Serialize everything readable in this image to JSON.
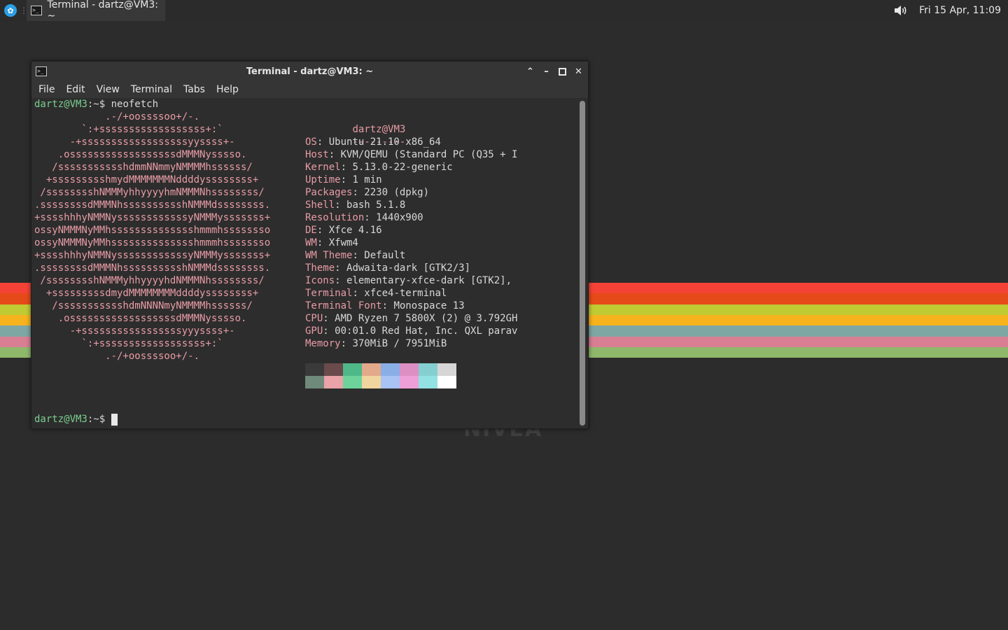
{
  "panel": {
    "app_menu_icon": "xfce-mouse-icon",
    "task_title": "Terminal - dartz@VM3: ~",
    "clock": "Fri 15 Apr, 11:09",
    "volume_icon": "volume-icon"
  },
  "wallpaper": {
    "text": "NIVEA",
    "stripe_colors": [
      "#f44336",
      "#e64a19",
      "#c0ca33",
      "#f6b31e",
      "#7ea7a4",
      "#d97f93",
      "#8fb86b"
    ]
  },
  "window": {
    "title": "Terminal - dartz@VM3: ~",
    "menu": [
      "File",
      "Edit",
      "View",
      "Terminal",
      "Tabs",
      "Help"
    ]
  },
  "terminal": {
    "prompt_user": "dartz@VM3",
    "prompt_path": ":~$",
    "command": " neofetch",
    "ascii_lines": [
      "            .-/+oossssoo+/-.",
      "        `:+ssssssssssssssssss+:`",
      "      -+ssssssssssssssssssyyssss+-",
      "    .ossssssssssssssssssdMMMNysssso.",
      "   /ssssssssssshdmmNNmmyNMMMMhssssss/",
      "  +ssssssssshmydMMMMMMMNddddyssssssss+",
      " /sssssssshNMMMyhhyyyyhmNMMMNhssssssss/",
      ".ssssssssdMMMNhsssssssssshNMMMdssssssss.",
      "+sssshhhyNMMNyssssssssssssyNMMMysssssss+",
      "ossyNMMMNyMMhsssssssssssssshmmmhssssssso",
      "ossyNMMMNyMMhsssssssssssssshmmmhssssssso",
      "+sssshhhyNMMNyssssssssssssyNMMMysssssss+",
      ".ssssssssdMMMNhsssssssssshNMMMdssssssss.",
      " /sssssssshNMMMyhhyyyyhdNMMMNhssssssss/",
      "  +sssssssssdmydMMMMMMMMddddyssssssss+",
      "   /ssssssssssshdmNNNNmyNMMMMhssssss/",
      "    .ossssssssssssssssssdMMMNysssso.",
      "      -+sssssssssssssssssyyyssss+-",
      "        `:+ssssssssssssssssss+:`",
      "            .-/+oossssoo+/-."
    ],
    "info_header": "dartz@VM3",
    "info_sep": "---------",
    "info": [
      {
        "key": "OS",
        "value": "Ubuntu 21.10 x86_64"
      },
      {
        "key": "Host",
        "value": "KVM/QEMU (Standard PC (Q35 + I"
      },
      {
        "key": "Kernel",
        "value": "5.13.0-22-generic"
      },
      {
        "key": "Uptime",
        "value": "1 min"
      },
      {
        "key": "Packages",
        "value": "2230 (dpkg)"
      },
      {
        "key": "Shell",
        "value": "bash 5.1.8"
      },
      {
        "key": "Resolution",
        "value": "1440x900"
      },
      {
        "key": "DE",
        "value": "Xfce 4.16"
      },
      {
        "key": "WM",
        "value": "Xfwm4"
      },
      {
        "key": "WM Theme",
        "value": "Default"
      },
      {
        "key": "Theme",
        "value": "Adwaita-dark [GTK2/3]"
      },
      {
        "key": "Icons",
        "value": "elementary-xfce-dark [GTK2],"
      },
      {
        "key": "Terminal",
        "value": "xfce4-terminal"
      },
      {
        "key": "Terminal Font",
        "value": "Monospace 13"
      },
      {
        "key": "CPU",
        "value": "AMD Ryzen 7 5800X (2) @ 3.792GH"
      },
      {
        "key": "GPU",
        "value": "00:01.0 Red Hat, Inc. QXL parav"
      },
      {
        "key": "Memory",
        "value": "370MiB / 7951MiB"
      }
    ],
    "palette_top": [
      "#3a3a3a",
      "#6b4a4c",
      "#4fb889",
      "#e3a98b",
      "#8aaee6",
      "#dd8fc4",
      "#86cfd0",
      "#d6d6d6"
    ],
    "palette_bottom": [
      "#6f8a7a",
      "#eaa3a8",
      "#6ed39b",
      "#f1d59e",
      "#a8c3f4",
      "#ee9fd8",
      "#93e2e3",
      "#ffffff"
    ],
    "final_prompt_user": "dartz@VM3",
    "final_prompt_path": ":~$"
  }
}
